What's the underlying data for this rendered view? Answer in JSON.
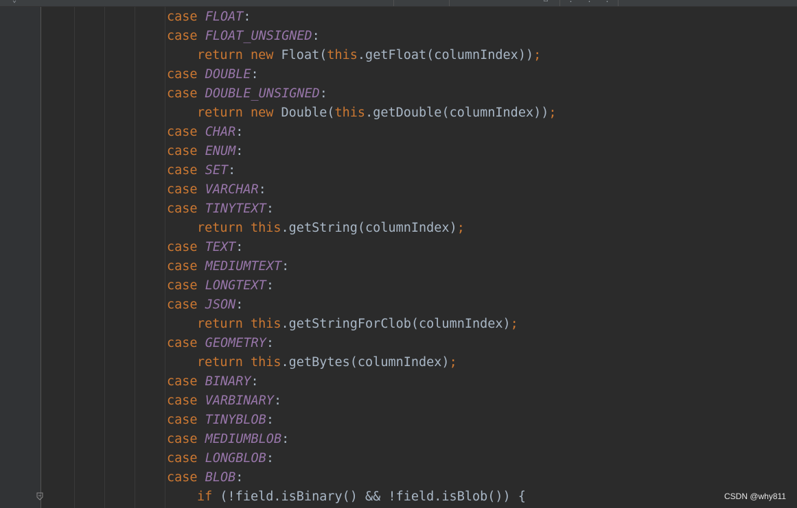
{
  "colors": {
    "background": "#2b2b2b",
    "gutter": "#313335",
    "keyword": "#cc7832",
    "constant": "#9876aa",
    "text": "#a9b7c6"
  },
  "code_lines": [
    {
      "kind": "case",
      "kw": "case",
      "name": "FLOAT",
      "punct": ":"
    },
    {
      "kind": "case",
      "kw": "case",
      "name": "FLOAT_UNSIGNED",
      "punct": ":"
    },
    {
      "kind": "return-new",
      "kw1": "return",
      "kw2": "new",
      "pre": " Float(",
      "this": "this",
      "post": ".getFloat(columnIndex))",
      "semi": ";"
    },
    {
      "kind": "case",
      "kw": "case",
      "name": "DOUBLE",
      "punct": ":"
    },
    {
      "kind": "case",
      "kw": "case",
      "name": "DOUBLE_UNSIGNED",
      "punct": ":"
    },
    {
      "kind": "return-new",
      "kw1": "return",
      "kw2": "new",
      "pre": " Double(",
      "this": "this",
      "post": ".getDouble(columnIndex))",
      "semi": ";"
    },
    {
      "kind": "case",
      "kw": "case",
      "name": "CHAR",
      "punct": ":"
    },
    {
      "kind": "case",
      "kw": "case",
      "name": "ENUM",
      "punct": ":"
    },
    {
      "kind": "case",
      "kw": "case",
      "name": "SET",
      "punct": ":"
    },
    {
      "kind": "case",
      "kw": "case",
      "name": "VARCHAR",
      "punct": ":"
    },
    {
      "kind": "case",
      "kw": "case",
      "name": "TINYTEXT",
      "punct": ":"
    },
    {
      "kind": "return-this",
      "kw1": "return",
      "this": "this",
      "post": ".getString(columnIndex)",
      "semi": ";"
    },
    {
      "kind": "case",
      "kw": "case",
      "name": "TEXT",
      "punct": ":"
    },
    {
      "kind": "case",
      "kw": "case",
      "name": "MEDIUMTEXT",
      "punct": ":"
    },
    {
      "kind": "case",
      "kw": "case",
      "name": "LONGTEXT",
      "punct": ":"
    },
    {
      "kind": "case",
      "kw": "case",
      "name": "JSON",
      "punct": ":"
    },
    {
      "kind": "return-this",
      "kw1": "return",
      "this": "this",
      "post": ".getStringForClob(columnIndex)",
      "semi": ";"
    },
    {
      "kind": "case",
      "kw": "case",
      "name": "GEOMETRY",
      "punct": ":"
    },
    {
      "kind": "return-this",
      "kw1": "return",
      "this": "this",
      "post": ".getBytes(columnIndex)",
      "semi": ";"
    },
    {
      "kind": "case",
      "kw": "case",
      "name": "BINARY",
      "punct": ":"
    },
    {
      "kind": "case",
      "kw": "case",
      "name": "VARBINARY",
      "punct": ":"
    },
    {
      "kind": "case",
      "kw": "case",
      "name": "TINYBLOB",
      "punct": ":"
    },
    {
      "kind": "case",
      "kw": "case",
      "name": "MEDIUMBLOB",
      "punct": ":"
    },
    {
      "kind": "case",
      "kw": "case",
      "name": "LONGBLOB",
      "punct": ":"
    },
    {
      "kind": "case",
      "kw": "case",
      "name": "BLOB",
      "punct": ":"
    },
    {
      "kind": "if",
      "kw1": "if",
      "post": " (!field.isBinary() && !field.isBlob()) {"
    }
  ],
  "watermark": "CSDN @why811"
}
